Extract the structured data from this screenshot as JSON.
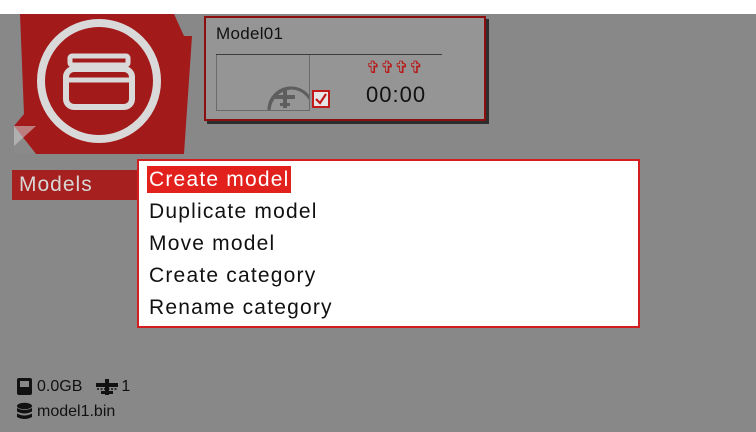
{
  "header": {
    "icon": "model-folder-icon"
  },
  "model_card": {
    "name": "Model01",
    "stars": "✞✞✞✞",
    "timer": "00:00",
    "thumbnail_icon": "airplane-icon",
    "check_icon": "checkbox-checked-icon"
  },
  "section": {
    "label": "Models"
  },
  "menu": {
    "items": [
      {
        "label": "Create model",
        "selected": true
      },
      {
        "label": "Duplicate model",
        "selected": false
      },
      {
        "label": "Move model",
        "selected": false
      },
      {
        "label": "Create category",
        "selected": false
      },
      {
        "label": "Rename category",
        "selected": false
      }
    ]
  },
  "footer": {
    "storage": "0.0GB",
    "model_count": "1",
    "filename": "model1.bin",
    "sd_icon": "sd-card-icon",
    "model_icon": "airplane-icon",
    "db_icon": "database-icon"
  },
  "colors": {
    "accent": "#e2211d",
    "dark_red": "#a5201e",
    "background": "#888888"
  }
}
